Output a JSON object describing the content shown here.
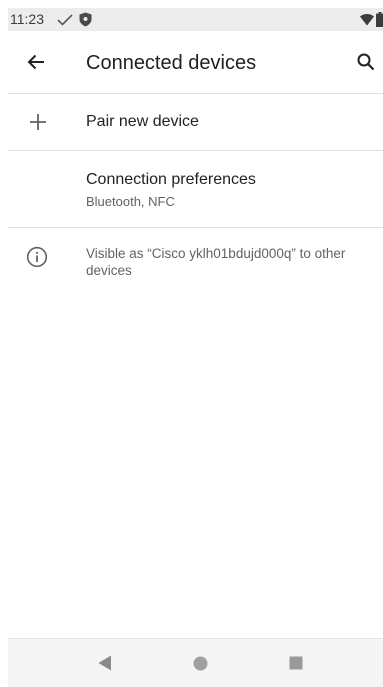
{
  "status_bar": {
    "time": "11:23",
    "icons": [
      "check-icon",
      "shield-icon",
      "wifi-icon",
      "battery-icon"
    ]
  },
  "app_bar": {
    "title": "Connected devices",
    "back_icon": "arrow-back-icon",
    "search_icon": "search-icon"
  },
  "list": {
    "pair_new": {
      "label": "Pair new device",
      "icon": "plus-icon"
    },
    "connection_prefs": {
      "label": "Connection preferences",
      "summary": "Bluetooth, NFC"
    },
    "visibility": {
      "icon": "info-icon",
      "text": "Visible as “Cisco yklh01bdujd000q” to other devices"
    }
  },
  "nav_bar": {
    "icons": [
      "nav-back-icon",
      "nav-home-icon",
      "nav-recents-icon"
    ]
  },
  "colors": {
    "status_bar_bg": "#ececec",
    "divider": "#e0e0e0",
    "primary_text": "#202124",
    "secondary_text": "#5f6368",
    "nav_bar_bg": "#f5f5f5",
    "nav_icon": "#9e9e9e"
  }
}
